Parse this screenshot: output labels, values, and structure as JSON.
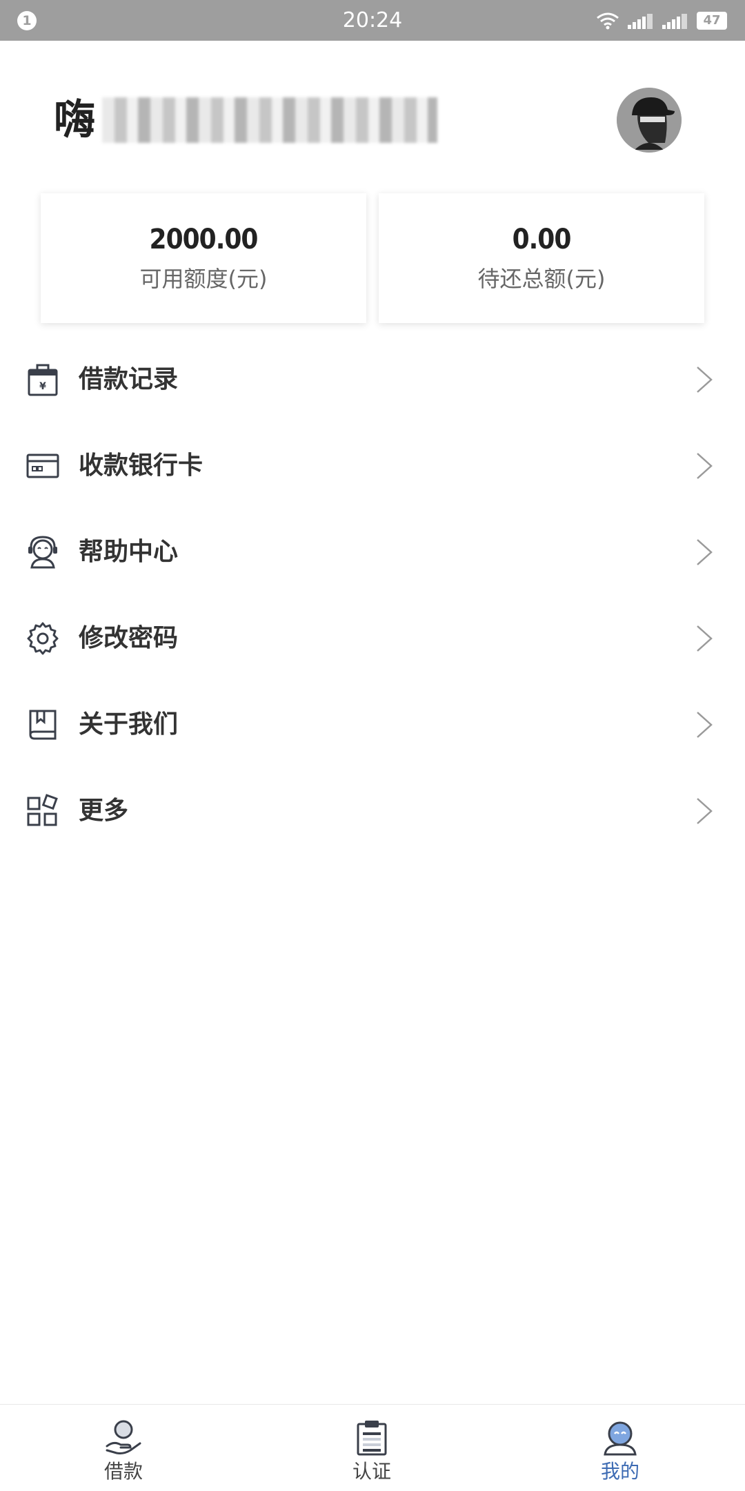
{
  "status_bar": {
    "notification_count": "1",
    "time": "20:24",
    "battery": "47",
    "icons": [
      "wifi-icon",
      "signal-1-icon",
      "signal-2-icon",
      "battery-icon"
    ]
  },
  "header": {
    "greeting": "嗨",
    "avatar_icon": "avatar-icon"
  },
  "summary": {
    "available_amount": "2000.00",
    "available_label": "可用额度(元)",
    "pending_amount": "0.00",
    "pending_label": "待还总额(元)"
  },
  "menu": {
    "items": [
      {
        "label": "借款记录",
        "icon": "loan-record-icon"
      },
      {
        "label": "收款银行卡",
        "icon": "bank-card-icon"
      },
      {
        "label": "帮助中心",
        "icon": "customer-service-icon"
      },
      {
        "label": "修改密码",
        "icon": "gear-icon"
      },
      {
        "label": "关于我们",
        "icon": "book-icon"
      },
      {
        "label": "更多",
        "icon": "apps-grid-icon"
      }
    ]
  },
  "tab_bar": {
    "active": "我的",
    "active_color": "#3d6bb3",
    "tabs": [
      {
        "label": "借款",
        "icon": "loan-hand-icon"
      },
      {
        "label": "认证",
        "icon": "clipboard-icon"
      },
      {
        "label": "我的",
        "icon": "profile-icon"
      }
    ]
  }
}
